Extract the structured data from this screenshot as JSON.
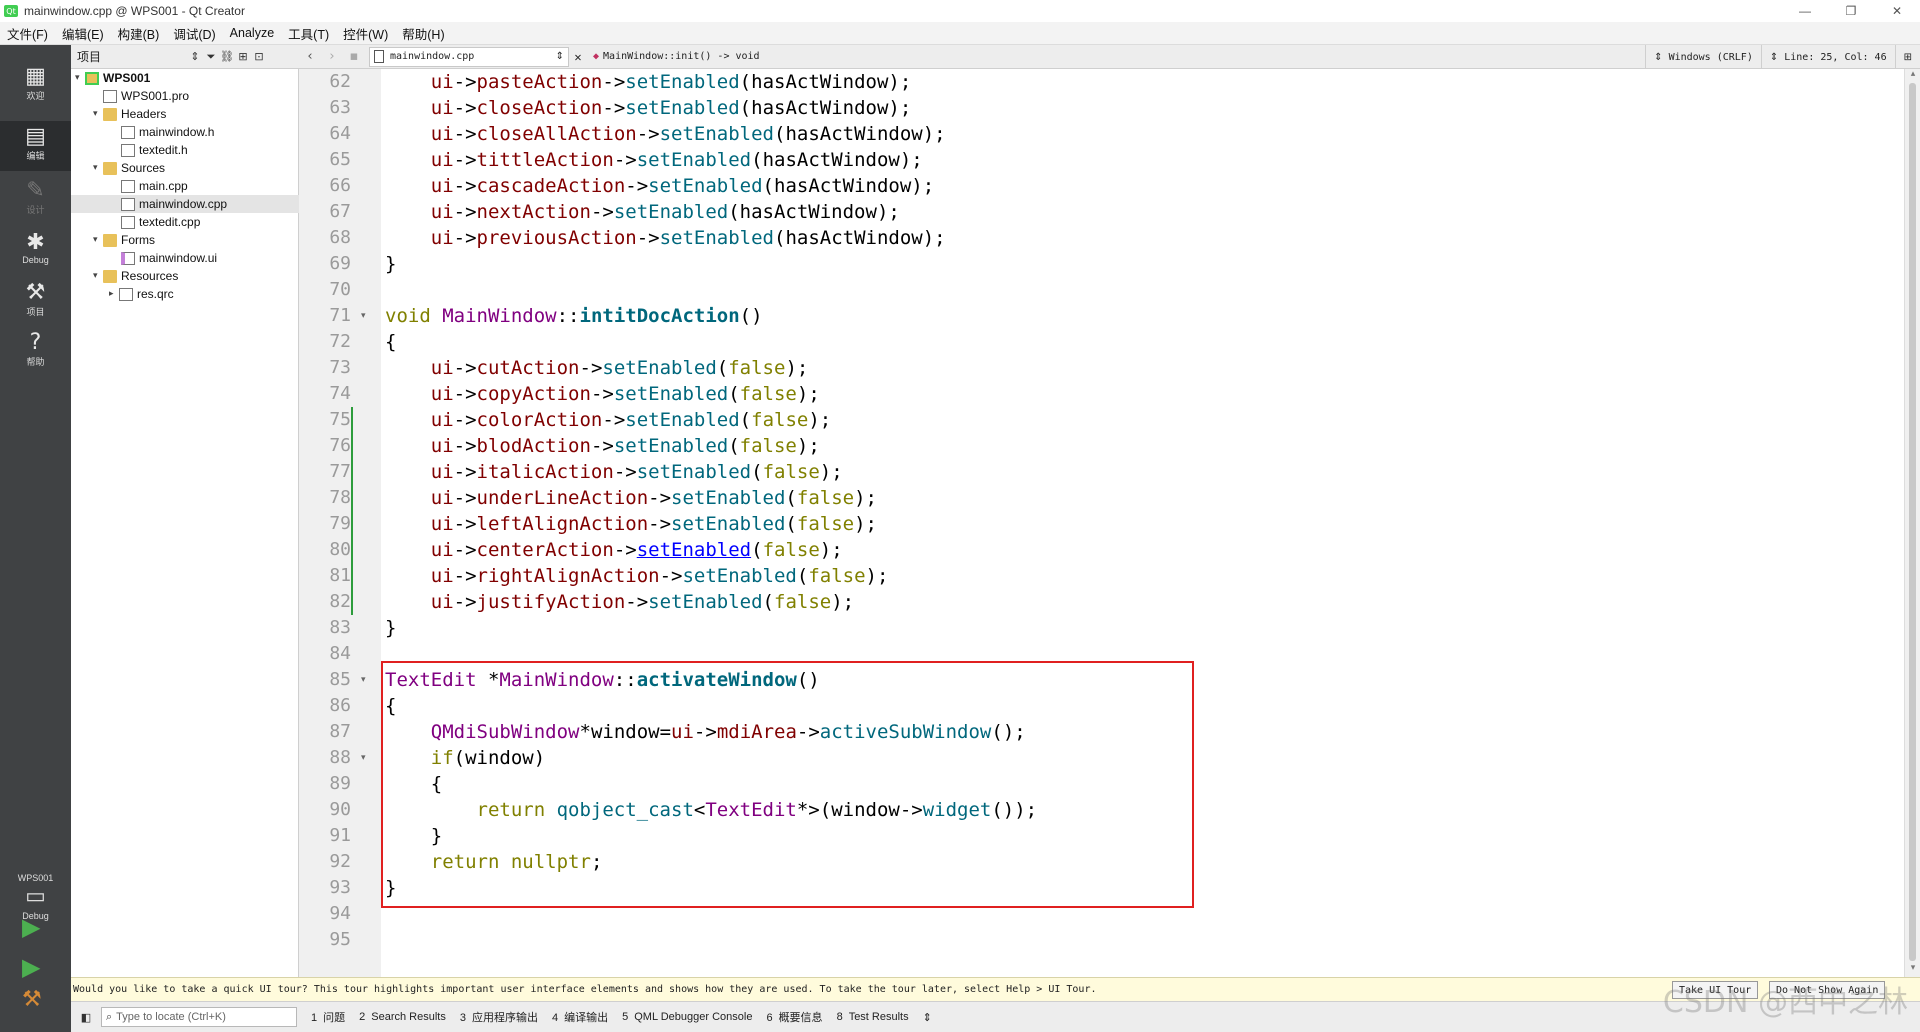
{
  "window": {
    "title": "mainwindow.cpp @ WPS001 - Qt Creator",
    "app_icon_text": "Qt",
    "minimize": "—",
    "maximize": "❐",
    "close": "✕"
  },
  "menu": [
    "文件(F)",
    "编辑(E)",
    "构建(B)",
    "调试(D)",
    "Analyze",
    "工具(T)",
    "控件(W)",
    "帮助(H)"
  ],
  "modes": {
    "welcome": "欢迎",
    "edit": "编辑",
    "design": "设计",
    "debug": "Debug",
    "projects": "项目",
    "help": "帮助"
  },
  "kit": {
    "name": "WPS001",
    "config": "Debug"
  },
  "project_panel": {
    "title": "项目",
    "tree": {
      "project": "WPS001",
      "pro_file": "WPS001.pro",
      "headers": "Headers",
      "header_files": [
        "mainwindow.h",
        "textedit.h"
      ],
      "sources": "Sources",
      "source_files": [
        "main.cpp",
        "mainwindow.cpp",
        "textedit.cpp"
      ],
      "forms": "Forms",
      "form_files": [
        "mainwindow.ui"
      ],
      "resources": "Resources",
      "resource_files": [
        "res.qrc"
      ]
    }
  },
  "editor_toolbar": {
    "file": "mainwindow.cpp",
    "function": "MainWindow::init() -> void",
    "line_ending": "Windows (CRLF)",
    "position": "Line: 25, Col: 46"
  },
  "code": {
    "line_numbers": [
      "62",
      "63",
      "64",
      "65",
      "66",
      "67",
      "68",
      "69",
      "70",
      "71",
      "72",
      "73",
      "74",
      "75",
      "76",
      "77",
      "78",
      "79",
      "80",
      "81",
      "82",
      "83",
      "84",
      "85",
      "86",
      "87",
      "88",
      "89",
      "90",
      "91",
      "92",
      "93",
      "94",
      "95"
    ]
  },
  "infobar": {
    "message": "Would you like to take a quick UI tour? This tour highlights important user interface elements and shows how they are used. To take the tour later, select Help > UI Tour.",
    "take_tour": "Take UI Tour",
    "do_not_show": "Do Not Show Again"
  },
  "statusbar": {
    "locator_placeholder": "Type to locate (Ctrl+K)",
    "tabs": [
      {
        "num": "1",
        "label": "问题"
      },
      {
        "num": "2",
        "label": "Search Results"
      },
      {
        "num": "3",
        "label": "应用程序输出"
      },
      {
        "num": "4",
        "label": "编译输出"
      },
      {
        "num": "5",
        "label": "QML Debugger Console"
      },
      {
        "num": "6",
        "label": "概要信息"
      },
      {
        "num": "8",
        "label": "Test Results"
      }
    ]
  },
  "watermark": "CSDN @西中之林"
}
